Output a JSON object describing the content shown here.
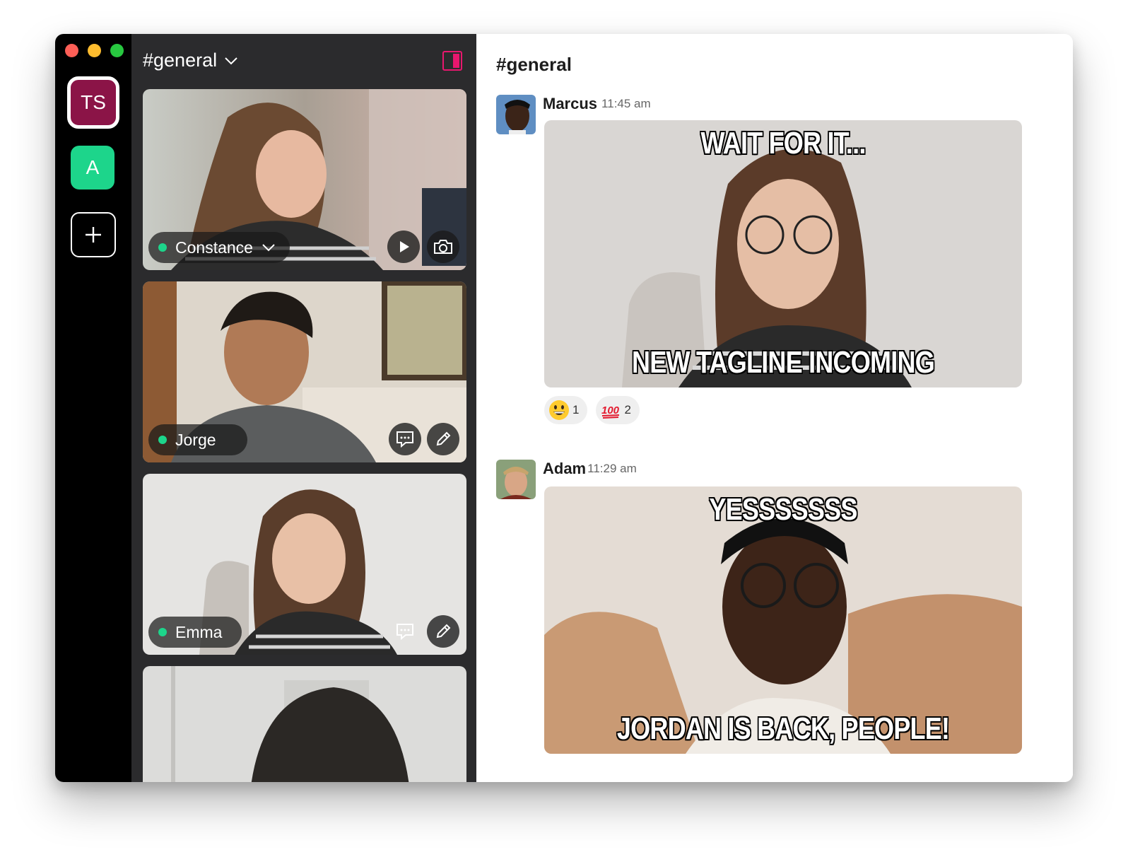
{
  "workspaces": [
    {
      "label": "TS",
      "color": "#8b1447"
    },
    {
      "label": "A",
      "color": "#1dd58b"
    },
    {
      "label": "+",
      "icon": "plus-icon"
    }
  ],
  "video_panel": {
    "channel": "#general",
    "tiles": [
      {
        "name": "Constance",
        "status": "online",
        "buttons": [
          "play-icon",
          "camera-icon"
        ]
      },
      {
        "name": "Jorge",
        "status": "online",
        "buttons": [
          "chat-bubble-icon",
          "pencil-icon"
        ]
      },
      {
        "name": "Emma",
        "status": "online",
        "buttons": [
          "chat-bubble-icon",
          "pencil-icon"
        ]
      },
      {
        "name": "",
        "status": ""
      }
    ]
  },
  "chat": {
    "channel": "#general",
    "messages": [
      {
        "author": "Marcus",
        "time": "11:45 am",
        "meme_top": "WAIT FOR IT...",
        "meme_bottom": "NEW TAGLINE INCOMING",
        "reactions": [
          {
            "emoji": "grinning-face",
            "count": "1"
          },
          {
            "emoji": "hundred-points",
            "count": "2"
          }
        ]
      },
      {
        "author": "Adam",
        "time": "11:29 am",
        "meme_top": "YESSSSSSS",
        "meme_bottom": "JORDAN IS BACK, PEOPLE!"
      }
    ]
  },
  "colors": {
    "accent": "#e8176e",
    "online": "#1dd58b",
    "workspace_ts": "#8b1447",
    "panel_bg": "#2b2b2d"
  }
}
